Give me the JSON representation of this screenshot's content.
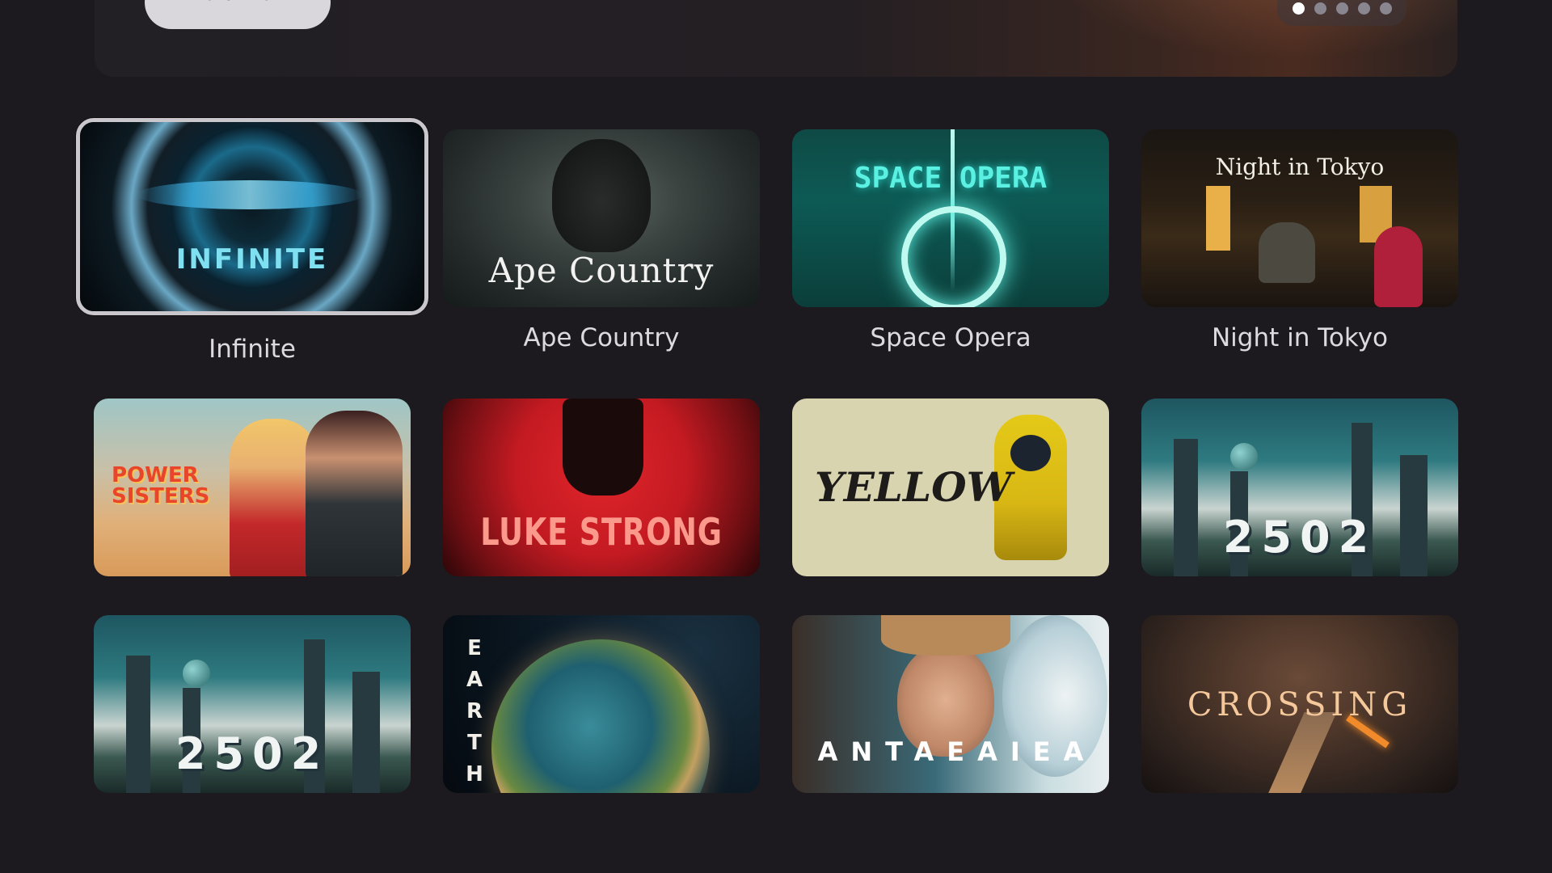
{
  "hero": {
    "watch_label": "Watch now",
    "slide_count": 5,
    "active_slide": 1
  },
  "grid": {
    "focused_index": 0,
    "items": [
      {
        "title": "Infinite",
        "art_text": "INFINITE",
        "label": "Infinite"
      },
      {
        "title": "Ape Country",
        "art_text": "Ape Country",
        "label": "Ape Country"
      },
      {
        "title": "Space Opera",
        "art_text": "SPACE OPERA",
        "label": "Space Opera"
      },
      {
        "title": "Night in Tokyo",
        "art_text": "Night in Tokyo",
        "label": "Night in Tokyo"
      },
      {
        "title": "Power Sisters",
        "art_text": "POWER SISTERS",
        "label": ""
      },
      {
        "title": "Luke Strong",
        "art_text": "LUKE STRONG",
        "label": ""
      },
      {
        "title": "Yellow",
        "art_text": "YELLOW",
        "label": ""
      },
      {
        "title": "2502",
        "art_text": "2502",
        "label": ""
      },
      {
        "title": "2502",
        "art_text": "2502",
        "label": ""
      },
      {
        "title": "Earth",
        "art_text": "EARTH",
        "label": ""
      },
      {
        "title": "Antaeaiea",
        "art_text": "ANTAEAIEA",
        "label": ""
      },
      {
        "title": "Crossing",
        "art_text": "CROSSING",
        "label": ""
      }
    ]
  },
  "colors": {
    "background": "#1d1a1f",
    "focus_border": "#c9c6cc",
    "label_text": "#dcd9df"
  }
}
